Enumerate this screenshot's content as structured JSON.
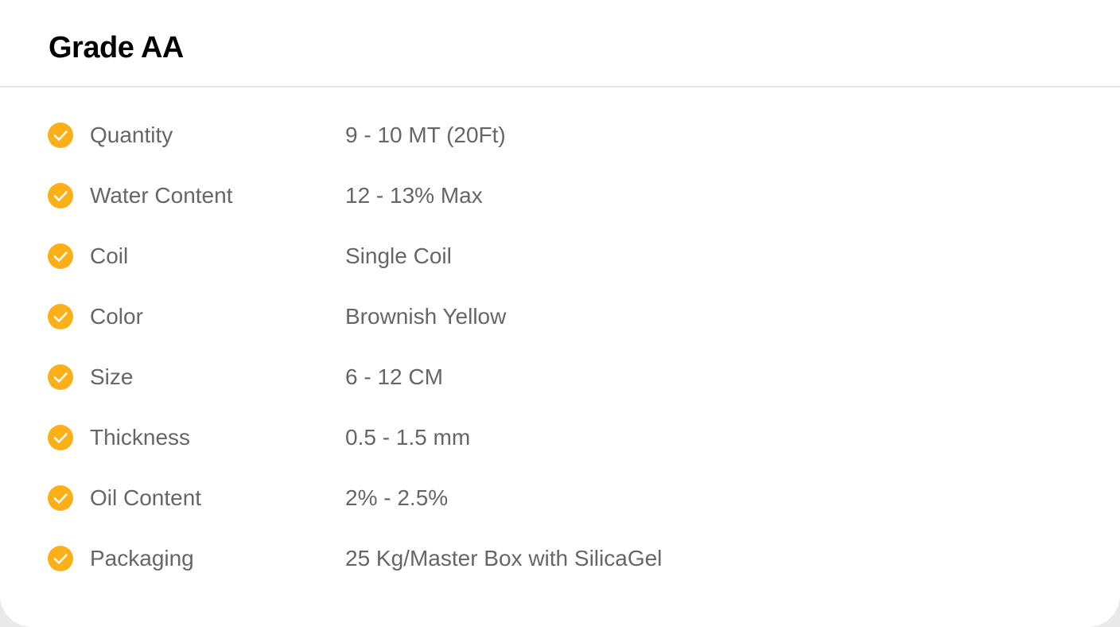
{
  "card": {
    "title": "Grade AA"
  },
  "colors": {
    "accent": "#FDAF17",
    "text": "#666666",
    "title": "#000000",
    "divider": "#E6E6E6"
  },
  "specs": [
    {
      "label": "Quantity",
      "value": "9 - 10 MT (20Ft)",
      "icon": "check-circle-icon"
    },
    {
      "label": "Water Content",
      "value": "12 - 13% Max",
      "icon": "check-circle-icon"
    },
    {
      "label": "Coil",
      "value": "Single Coil",
      "icon": "check-circle-icon"
    },
    {
      "label": "Color",
      "value": "Brownish Yellow",
      "icon": "check-circle-icon"
    },
    {
      "label": "Size",
      "value": "6 - 12 CM",
      "icon": "check-circle-icon"
    },
    {
      "label": "Thickness",
      "value": "0.5 - 1.5 mm",
      "icon": "check-circle-icon"
    },
    {
      "label": "Oil Content",
      "value": "2% - 2.5%",
      "icon": "check-circle-icon"
    },
    {
      "label": "Packaging",
      "value": "25 Kg/Master Box with SilicaGel",
      "icon": "check-circle-icon"
    }
  ]
}
